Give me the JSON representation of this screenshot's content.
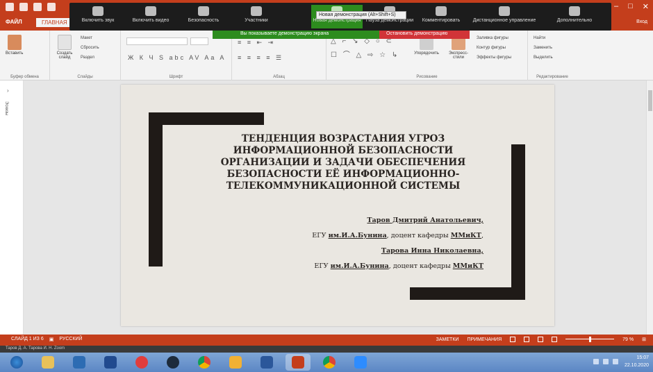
{
  "window": {
    "file_tab": "ФАЙЛ",
    "home_tab": "ГЛАВНАЯ",
    "extra_tab": "Вход"
  },
  "zoom_toolbar": {
    "buttons": [
      "Включить звук",
      "Включить видео",
      "Безопасность",
      "Участники",
      "Новая демонстрация",
      "Пауза демонстрации",
      "Комментировать",
      "Дистанционное управление",
      "Дополнительно"
    ],
    "tooltip": "Новая демонстрация (Alt+Shift+S)"
  },
  "share_banner": {
    "status": "Вы показываете демонстрацию экрана",
    "stop": "Остановить демонстрацию"
  },
  "ribbon": {
    "paste": "Вставить",
    "create_slide": "Создать слайд",
    "layout": "Макет",
    "reset": "Сбросить",
    "section": "Раздел",
    "arrange": "Упорядочить",
    "quick_styles": "Экспресс-стили",
    "fill": "Заливка фигуры",
    "outline": "Контур фигуры",
    "effects": "Эффекты фигуры",
    "find": "Найти",
    "replace": "Заменить",
    "select": "Выделить",
    "groups": [
      "Буфер обмена",
      "Слайды",
      "Шрифт",
      "Абзац",
      "Рисование",
      "Редактирование"
    ]
  },
  "left_pane": {
    "label": "Эскизы"
  },
  "slide": {
    "title_lines": [
      "ТЕНДЕНЦИЯ ВОЗРАСТАНИЯ УГРОЗ",
      "ИНФОРМАЦИОННОЙ БЕЗОПАСНОСТИ",
      "ОРГАНИЗАЦИИ И ЗАДАЧИ ОБЕСПЕЧЕНИЯ",
      "БЕЗОПАСНОСТИ ЕЁ ИНФОРМАЦИОННО-",
      "ТЕЛЕКОММУНИКАЦИОННОЙ СИСТЕМЫ"
    ],
    "author1_name": "Таров Дмитрий Анатольевич,",
    "author1_aff_a": "ЕГУ ",
    "author1_aff_b": "им.И.А.Бунина",
    "author1_aff_c": ", доцент кафедры ",
    "author1_aff_d": "ММиКТ",
    "author1_aff_e": ",",
    "author2_name": "Тарова Инна Николаевна,",
    "author2_aff_a": "ЕГУ ",
    "author2_aff_b": "им.И.А.Бунина",
    "author2_aff_c": ", доцент кафедры ",
    "author2_aff_d": "ММиКТ"
  },
  "status_bar": {
    "slide_info": "СЛАЙД 1 ИЗ 6",
    "language": "РУССКИЙ",
    "notes": "ЗАМЕТКИ",
    "comments": "ПРИМЕЧАНИЯ",
    "zoom": "79 %",
    "zoom_level": 0.5
  },
  "zoom_strip": {
    "text": "Таров Д. А.     Тарова И. Н.     Zoom"
  },
  "taskbar": {
    "time": "15:07",
    "date": "22.10.2020"
  },
  "colors": {
    "accent": "#c43e1c",
    "slide_bg": "#eae7e1",
    "frame": "#1f1a17"
  }
}
